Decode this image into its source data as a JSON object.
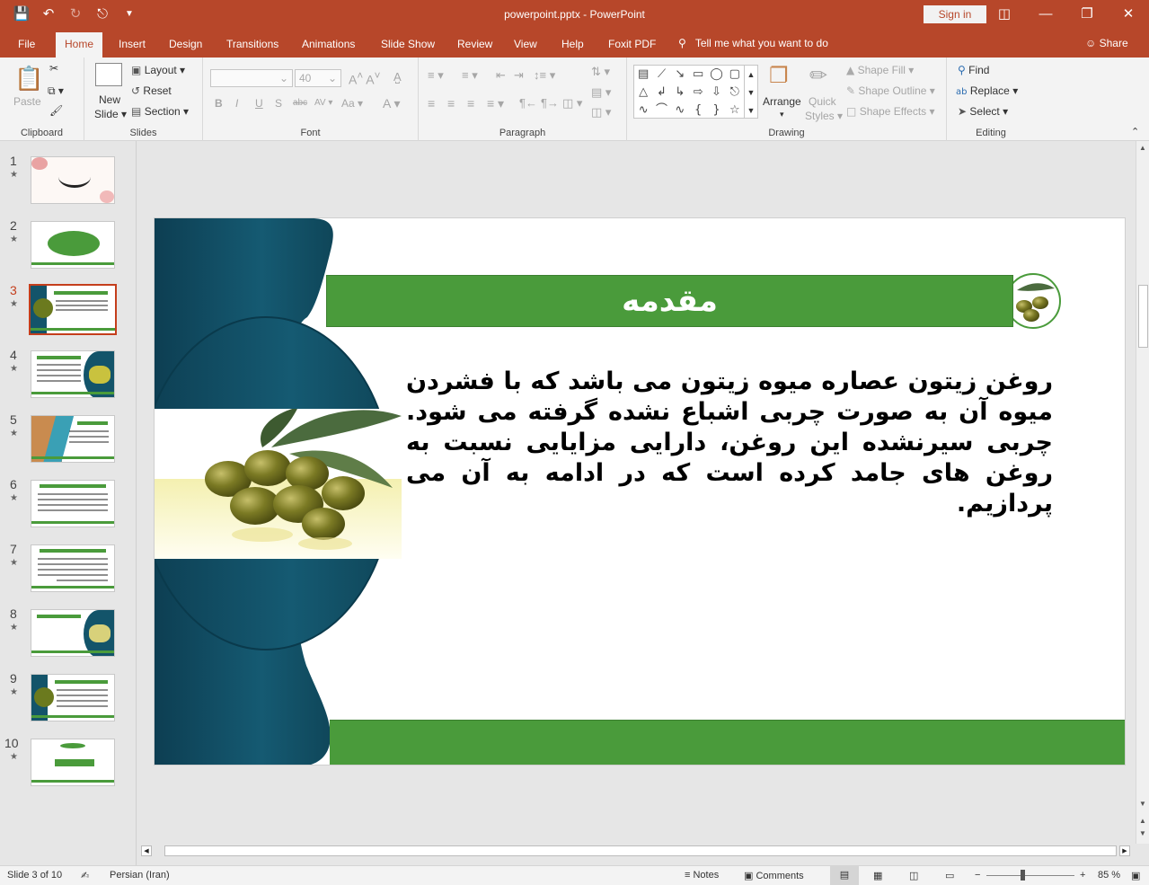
{
  "window": {
    "doc_title": "powerpoint.pptx  -  PowerPoint",
    "sign_in": "Sign in",
    "qat_icons": [
      "save-icon",
      "undo-icon",
      "redo-icon",
      "presenter-icon",
      "customize-icon"
    ],
    "win_controls": [
      "ribbon-display-icon",
      "minimize-icon",
      "restore-icon",
      "close-icon"
    ]
  },
  "ribbon_tabs": [
    "File",
    "Home",
    "Insert",
    "Design",
    "Transitions",
    "Animations",
    "Slide Show",
    "Review",
    "View",
    "Help",
    "Foxit PDF"
  ],
  "active_tab": "Home",
  "tell_me": "Tell me what you want to do",
  "share": "Share",
  "ribbon": {
    "clipboard": {
      "label": "Clipboard",
      "paste": "Paste"
    },
    "slides": {
      "label": "Slides",
      "new_slide": "New",
      "new_slide_2": "Slide",
      "layout": "Layout",
      "reset": "Reset",
      "section": "Section"
    },
    "font": {
      "label": "Font",
      "font_size": "40"
    },
    "paragraph": {
      "label": "Paragraph"
    },
    "drawing": {
      "label": "Drawing",
      "arrange": "Arrange",
      "quick_styles": "Quick",
      "quick_styles_2": "Styles",
      "shape_fill": "Shape Fill",
      "shape_outline": "Shape Outline",
      "shape_effects": "Shape Effects"
    },
    "editing": {
      "label": "Editing",
      "find": "Find",
      "replace": "Replace",
      "select": "Select"
    }
  },
  "thumbnails": [
    {
      "num": "1",
      "star": "★",
      "kind": "calligraphy"
    },
    {
      "num": "2",
      "star": "★",
      "kind": "green-oval"
    },
    {
      "num": "3",
      "star": "★",
      "kind": "title-text",
      "selected": true
    },
    {
      "num": "4",
      "star": "★",
      "kind": "text-image"
    },
    {
      "num": "5",
      "star": "★",
      "kind": "image-text"
    },
    {
      "num": "6",
      "star": "★",
      "kind": "text"
    },
    {
      "num": "7",
      "star": "★",
      "kind": "text"
    },
    {
      "num": "8",
      "star": "★",
      "kind": "text-image"
    },
    {
      "num": "9",
      "star": "★",
      "kind": "image-text"
    },
    {
      "num": "10",
      "star": "★",
      "kind": "link"
    }
  ],
  "slide": {
    "title": "مقدمه",
    "body": "روغن زیتون عصاره میوه زیتون می باشد که با فشردن میوه آن به صورت چربی اشباع نشده گرفته می شود. چربی سیرنشده این روغن، دارایی مزایایی نسبت به روغن های جامد کرده است که در ادامه به آن می پردازیم."
  },
  "statusbar": {
    "slide_info": "Slide 3 of 10",
    "language": "Persian (Iran)",
    "notes": "Notes",
    "comments": "Comments",
    "zoom": "85 %",
    "zoom_level": 0.85
  },
  "colors": {
    "accent": "#b7472a",
    "slide_green": "#4a9b3b",
    "teal": "#13546a",
    "olive": "#6b7a1e"
  }
}
